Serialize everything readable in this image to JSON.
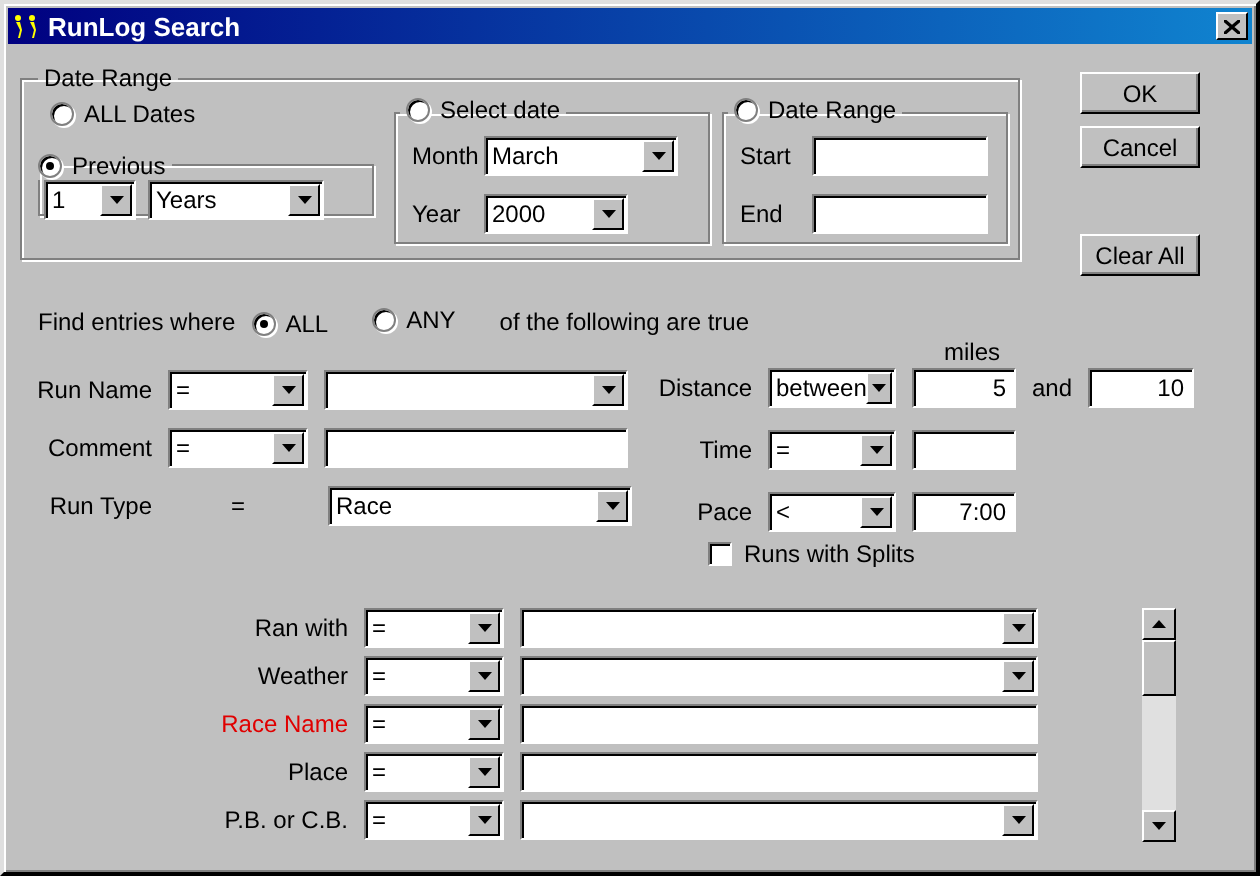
{
  "window": {
    "title": "RunLog Search"
  },
  "date_range": {
    "label": "Date Range",
    "all_dates": {
      "label": "ALL Dates",
      "selected": false
    },
    "previous": {
      "label": "Previous",
      "selected": true,
      "count": "1",
      "unit": "Years"
    },
    "select_date": {
      "label": "Select date",
      "selected": false,
      "month_label": "Month",
      "month": "March",
      "year_label": "Year",
      "year": "2000"
    },
    "range": {
      "label": "Date Range",
      "selected": false,
      "start_label": "Start",
      "end_label": "End"
    }
  },
  "buttons": [
    {
      "label": "OK"
    },
    {
      "label": "Cancel"
    },
    {
      "label": "Clear All"
    }
  ],
  "match": {
    "prefix": "Find entries where",
    "options": [
      {
        "label": "ALL",
        "selected": true
      },
      {
        "label": "ANY",
        "selected": false
      }
    ],
    "suffix": "of the following are true"
  },
  "criteria_left": [
    {
      "label": "Run Name",
      "kind": "combo",
      "operator": "="
    },
    {
      "label": "Comment",
      "kind": "text",
      "operator": "="
    },
    {
      "label": "Run Type",
      "kind": "fixed",
      "operator": "=",
      "value": "Race"
    }
  ],
  "criteria_right": {
    "units": "miles",
    "rows": [
      {
        "label": "Distance",
        "operator": "between",
        "value": "5",
        "joiner": "and",
        "value2": "10"
      },
      {
        "label": "Time",
        "operator": "="
      },
      {
        "label": "Pace",
        "operator": "<",
        "value": "7:00"
      }
    ],
    "splits": {
      "label": "Runs with Splits",
      "checked": false
    }
  },
  "custom_fields": [
    {
      "label": "Ran with",
      "color": "#000000",
      "operator": "=",
      "kind": "combo"
    },
    {
      "label": "Weather",
      "color": "#000000",
      "operator": "=",
      "kind": "combo"
    },
    {
      "label": "Race Name",
      "color": "#e00000",
      "operator": "=",
      "kind": "text"
    },
    {
      "label": "Place",
      "color": "#000000",
      "operator": "=",
      "kind": "text"
    },
    {
      "label": "P.B. or C.B.",
      "color": "#000000",
      "operator": "=",
      "kind": "combo"
    }
  ]
}
